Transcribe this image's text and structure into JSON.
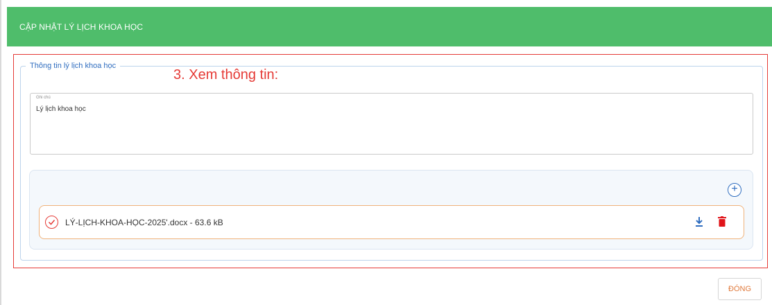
{
  "dialog": {
    "title": "CẬP NHẬT LÝ LỊCH KHOA HỌC",
    "colors": {
      "header": "#4fbd6b",
      "accent": "#2f6dbf",
      "annotation": "#e53935"
    }
  },
  "section": {
    "legend": "Thông tin lý lịch khoa học",
    "annotation": "3. Xem thông tin:"
  },
  "note": {
    "label": "Ghi chú",
    "value": "Lý lịch khoa học"
  },
  "attachments": {
    "add_icon": "plus-circle-icon",
    "add_symbol": "+",
    "files": [
      {
        "name": "LÝ-LỊCH-KHOA-HỌC-2025'.docx - 63.6 kB",
        "status_icon": "check-circle-icon",
        "actions": [
          "download-icon",
          "trash-icon"
        ]
      }
    ]
  },
  "footer": {
    "close_label": "ĐÓNG"
  }
}
